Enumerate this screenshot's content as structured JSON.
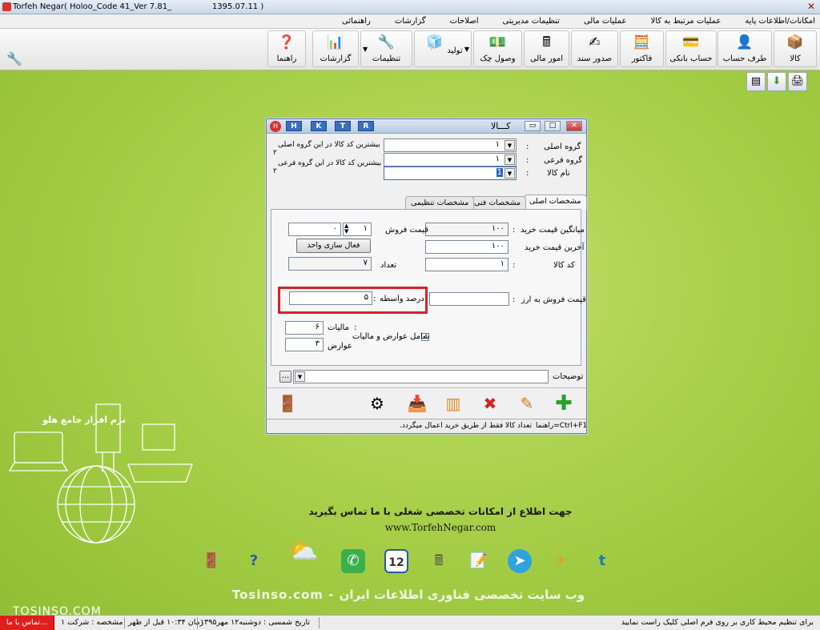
{
  "window": {
    "title": "Torfeh Negar( Holoo_Code 41_Ver 7.81_                1395.07.11 )"
  },
  "menu": [
    "امکانات/اطلاعات پایه",
    "عملیات مرتبط به کالا",
    "عملیات مالی",
    "تنظیمات مدیریتی",
    "اصلاحات",
    "گزارشات",
    "راهنمائی"
  ],
  "toolbar": {
    "kala": "کالا",
    "taraf": "طرف حساب",
    "bank": "حساب بانکی",
    "factor": "فاکتور",
    "sanad": "صدور سند",
    "mali": "امور مالی",
    "chek": "وصول چک",
    "tolid": "تولید",
    "tanzimat": "تنظیمات",
    "gozareshat": "گزارشات",
    "rahnama": "راهنما"
  },
  "dialog": {
    "title": "کـــالا",
    "hotkeys": [
      "H",
      "K",
      "T",
      "R"
    ],
    "group_main_label": "گروه اصلی",
    "group_main_value": "۱",
    "group_sub_label": "گروه فرعی",
    "group_sub_value": "۱",
    "item_name_label": "نام کالا",
    "item_name_value": "1",
    "max_code_main": "بیشترین کد کالا در این گروه اصلی",
    "max_code_main_val": "۲",
    "max_code_sub": "بیشترین کد کالا در این گروه فرعی",
    "max_code_sub_val": "۲",
    "tabs": [
      "مشخصات اصلی",
      "مشخصات فنی",
      "مشخصات تنظیمی"
    ],
    "avg_buy_label": "میانگین قیمت خرید",
    "avg_buy_value": "۱۰۰",
    "last_buy_label": "آخرین قیمت خرید",
    "last_buy_value": "۱۰۰",
    "code_label": "کد کالا",
    "code_value": "۱",
    "sell_price_label": "قیمت فروش",
    "sell_price_value": "۰",
    "sell_spin_value": "۱",
    "unit_btn": "فعال سازی واحد",
    "count_label": "تعداد",
    "count_value": "۷",
    "currency_label": "قیمت فروش به ارز",
    "commission_label": "درصد واسطه",
    "commission_value": "۵",
    "tax_label": "مالیات",
    "tax_value": "۶",
    "duty_label": "عوارض",
    "duty_value": "۳",
    "include_label": "شامل عوارض و مالیات",
    "desc_label": "توضیحات",
    "status_hint": "راهنما=Ctrl+F1",
    "status_msg": "تعداد کالا فقط از طریق خرید اعمال میگردد."
  },
  "illustration": {
    "caption": "نرم افزار جامع هلو"
  },
  "promo": {
    "line1": "جهت اطلاع از امکانات تخصصی شغلی با ما تماس بگیرید",
    "line2": "www.TorfehNegar.com"
  },
  "dock_calendar_day": "12",
  "watermark": {
    "main": "Tosinso.com - وب سایت تخصصی فناوری اطلاعات ایران",
    "corner": "TOSINSO.COM"
  },
  "statusbar": {
    "hint": "برای تنظیم محیط کاری بر روی فرم اصلی کلیک راست نمایید",
    "date": "تاریخ شمسی : دوشنبه۱۲ مهر۱۳۹۵",
    "time": "زمان ۱۰:۳۴ قبل از ظهر",
    "company": "مشخصه : شرکت ۱",
    "call": "تماس با ما..."
  },
  "colors": {
    "accent_red": "#d9202a",
    "desktop_green": "#a9d04a"
  }
}
